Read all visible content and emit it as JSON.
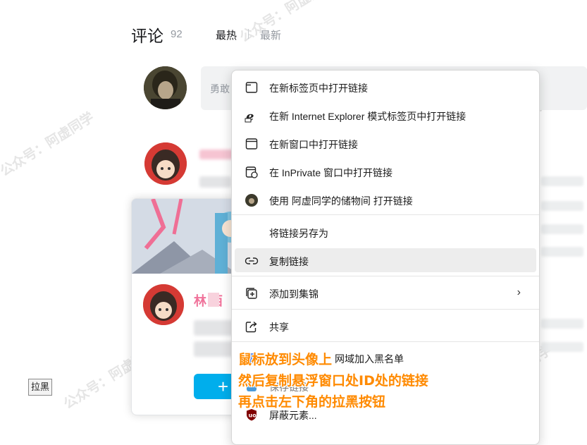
{
  "comments": {
    "title": "评论",
    "count": "92",
    "sort_hot": "最热",
    "sort_new": "最新",
    "input_placeholder": "勇敢"
  },
  "user_card": {
    "name": "林  西",
    "follow_label": "+"
  },
  "blacklist_button": "拉黑",
  "context_menu": {
    "items": [
      {
        "label": "在新标签页中打开链接",
        "icon": "new-tab-icon"
      },
      {
        "label": "在新 Internet Explorer 模式标签页中打开链接",
        "icon": "internet-explorer-icon"
      },
      {
        "label": "在新窗口中打开链接",
        "icon": "new-window-icon"
      },
      {
        "label": "在 InPrivate 窗口中打开链接",
        "icon": "inprivate-window-icon"
      },
      {
        "label": "使用 阿虚同学的储物间 打开链接",
        "icon": "profile-avatar-icon"
      },
      {
        "label": "将链接另存为",
        "icon": ""
      },
      {
        "label": "复制链接",
        "icon": "link-icon"
      },
      {
        "label": "添加到集锦",
        "icon": "collections-add-icon"
      },
      {
        "label": "共享",
        "icon": "share-icon"
      },
      {
        "label": "网域加入黑名单",
        "icon": "extension-icon"
      },
      {
        "label": "保存链接",
        "icon": "extension-icon"
      },
      {
        "label": "屏蔽元素...",
        "icon": "ublock-origin-icon"
      }
    ]
  },
  "overlay_instructions": [
    "鼠标放到头像上",
    "然后复制悬浮窗口处ID处的链接",
    "再点击左下角的拉黑按钮"
  ],
  "watermark": "公众号：阿虚同学",
  "colors": {
    "accent_blue": "#00aeec",
    "name_pink": "#f0729a",
    "instruction_orange": "#ff8a00",
    "menu_highlight": "#ededed"
  }
}
